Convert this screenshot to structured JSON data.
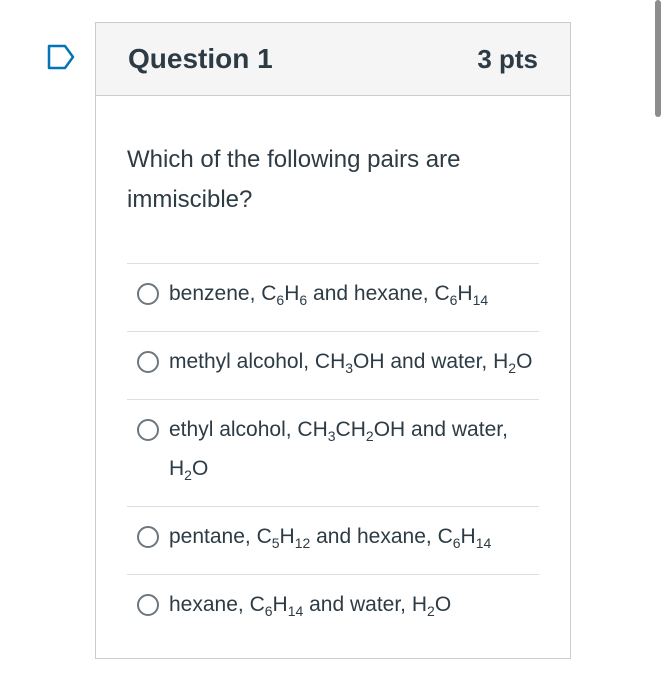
{
  "question": {
    "title": "Question 1",
    "points": "3 pts",
    "text": "Which of the following pairs are immiscible?"
  },
  "answers": [
    {
      "parts": [
        [
          "benzene, C",
          ""
        ],
        [
          "6",
          "sub"
        ],
        [
          "H",
          ""
        ],
        [
          "6",
          "sub"
        ],
        [
          " and hexane, C",
          ""
        ],
        [
          "6",
          "sub"
        ],
        [
          "H",
          ""
        ],
        [
          "14",
          "sub"
        ]
      ]
    },
    {
      "parts": [
        [
          "methyl alcohol, CH",
          ""
        ],
        [
          "3",
          "sub"
        ],
        [
          "OH and water, H",
          ""
        ],
        [
          "2",
          "sub"
        ],
        [
          "O",
          ""
        ]
      ]
    },
    {
      "parts": [
        [
          "ethyl alcohol, CH",
          ""
        ],
        [
          "3",
          "sub"
        ],
        [
          "CH",
          ""
        ],
        [
          "2",
          "sub"
        ],
        [
          "OH and water, H",
          ""
        ],
        [
          "2",
          "sub"
        ],
        [
          "O",
          ""
        ]
      ]
    },
    {
      "parts": [
        [
          "pentane, C",
          ""
        ],
        [
          "5",
          "sub"
        ],
        [
          "H",
          ""
        ],
        [
          "12",
          "sub"
        ],
        [
          " and hexane, C",
          ""
        ],
        [
          "6",
          "sub"
        ],
        [
          "H",
          ""
        ],
        [
          "14",
          "sub"
        ]
      ]
    },
    {
      "parts": [
        [
          "hexane, C",
          ""
        ],
        [
          "6",
          "sub"
        ],
        [
          "H",
          ""
        ],
        [
          "14",
          "sub"
        ],
        [
          " and water, H",
          ""
        ],
        [
          "2",
          "sub"
        ],
        [
          "O",
          ""
        ]
      ]
    }
  ],
  "colors": {
    "flag": "#0374b5",
    "text": "#2d3b45",
    "header_bg": "#f5f5f5"
  }
}
